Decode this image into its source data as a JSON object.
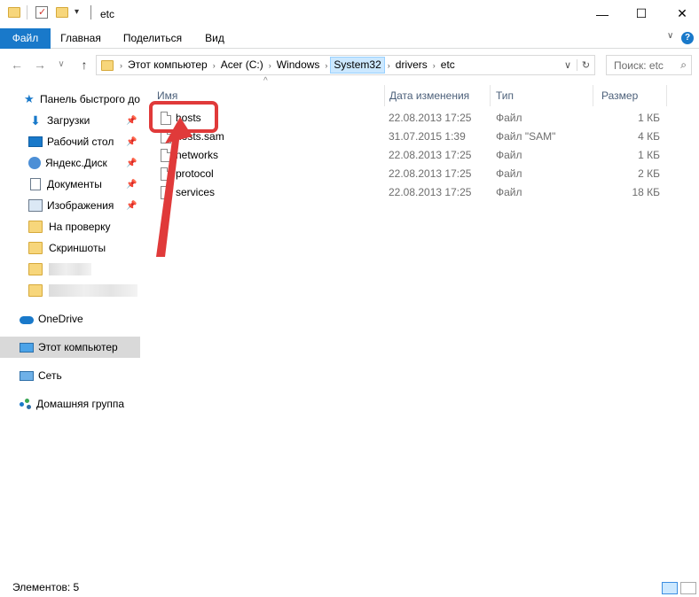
{
  "window": {
    "title": "etc",
    "minimize_glyph": "—",
    "maximize_glyph": "☐",
    "close_glyph": "✕"
  },
  "ribbon": {
    "tabs": [
      "Файл",
      "Главная",
      "Поделиться",
      "Вид"
    ],
    "help_glyph": "?"
  },
  "nav": {
    "back_glyph": "←",
    "forward_glyph": "→",
    "recent_glyph": "∨",
    "up_glyph": "↑",
    "breadcrumbs": [
      "Этот компьютер",
      "Acer (C:)",
      "Windows",
      "System32",
      "drivers",
      "etc"
    ],
    "separator": "›",
    "search_placeholder": "Поиск: etc"
  },
  "sidebar": {
    "items": [
      {
        "label": "Панель быстрого доступа",
        "icon": "star-icon"
      },
      {
        "label": "Загрузки",
        "icon": "download-icon",
        "pinned": true
      },
      {
        "label": "Рабочий стол",
        "icon": "desktop-icon",
        "pinned": true
      },
      {
        "label": "Яндекс.Диск",
        "icon": "yandex-disk-icon",
        "pinned": true
      },
      {
        "label": "Документы",
        "icon": "documents-icon",
        "pinned": true
      },
      {
        "label": "Изображения",
        "icon": "pictures-icon",
        "pinned": true
      },
      {
        "label": "На проверку",
        "icon": "folder-icon"
      },
      {
        "label": "Скриншоты",
        "icon": "folder-icon"
      },
      {
        "label": "",
        "icon": "folder-icon"
      },
      {
        "label": "",
        "icon": "folder-icon"
      },
      {
        "label": "OneDrive",
        "icon": "onedrive-icon"
      },
      {
        "label": "Этот компьютер",
        "icon": "computer-icon",
        "selected": true
      },
      {
        "label": "Сеть",
        "icon": "network-icon"
      },
      {
        "label": "Домашняя группа",
        "icon": "homegroup-icon"
      }
    ]
  },
  "columns": {
    "name": "Имя",
    "date": "Дата изменения",
    "type": "Тип",
    "size": "Размер"
  },
  "files": [
    {
      "name": "hosts",
      "date": "22.08.2013 17:25",
      "type": "Файл",
      "size": "1 КБ"
    },
    {
      "name": "hosts.sam",
      "date": "31.07.2015 1:39",
      "type": "Файл \"SAM\"",
      "size": "4 КБ"
    },
    {
      "name": "networks",
      "date": "22.08.2013 17:25",
      "type": "Файл",
      "size": "1 КБ"
    },
    {
      "name": "protocol",
      "date": "22.08.2013 17:25",
      "type": "Файл",
      "size": "2 КБ"
    },
    {
      "name": "services",
      "date": "22.08.2013 17:25",
      "type": "Файл",
      "size": "18 КБ"
    }
  ],
  "status": {
    "item_count": "Элементов: 5"
  },
  "colors": {
    "accent": "#1979ca",
    "selection": "#cce8ff",
    "annotation": "#e03a3a"
  }
}
